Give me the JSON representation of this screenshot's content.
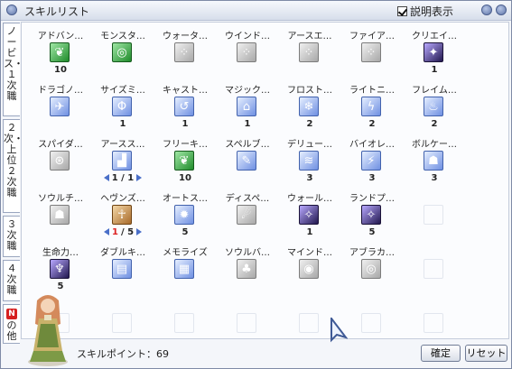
{
  "window": {
    "title": "スキルリスト",
    "show_description_label": "説明表示",
    "show_description_checked": true
  },
  "tabs": [
    {
      "label": "ノービス・１次職"
    },
    {
      "label": "２次・上位２次職"
    },
    {
      "label": "３次職"
    },
    {
      "label": "４次職"
    },
    {
      "badge": "N",
      "label": "の他"
    }
  ],
  "skills": [
    {
      "name": "アドバン…",
      "icon": "green-leaf-icon",
      "style": "green",
      "sym": "❦",
      "level": "10"
    },
    {
      "name": "モンスタ…",
      "icon": "target-icon",
      "style": "green",
      "sym": "◎",
      "level": ""
    },
    {
      "name": "ウォータ…",
      "icon": "dots-icon",
      "style": "gray",
      "sym": "⁘",
      "level": ""
    },
    {
      "name": "ウインド…",
      "icon": "dots-icon",
      "style": "gray",
      "sym": "⁘",
      "level": ""
    },
    {
      "name": "アースエ…",
      "icon": "dots-icon",
      "style": "gray",
      "sym": "⁘",
      "level": ""
    },
    {
      "name": "ファイア…",
      "icon": "dots-icon",
      "style": "gray",
      "sym": "⁘",
      "level": ""
    },
    {
      "name": "クリエイ…",
      "icon": "creature-icon",
      "style": "dark",
      "sym": "✦",
      "level": "1"
    },
    {
      "name": "ドラゴノ…",
      "icon": "dragon-icon",
      "style": "blue",
      "sym": "✈",
      "level": ""
    },
    {
      "name": "サイズミ…",
      "icon": "seismic-icon",
      "style": "blue",
      "sym": "Φ",
      "level": "1"
    },
    {
      "name": "キャスト…",
      "icon": "cast-icon",
      "style": "blue",
      "sym": "↺",
      "level": "1"
    },
    {
      "name": "マジック…",
      "icon": "magic-house-icon",
      "style": "blue",
      "sym": "⌂",
      "level": "1"
    },
    {
      "name": "フロスト…",
      "icon": "frost-icon",
      "style": "blue",
      "sym": "❄",
      "level": "2"
    },
    {
      "name": "ライトニ…",
      "icon": "lightning-icon",
      "style": "blue",
      "sym": "ϟ",
      "level": "2"
    },
    {
      "name": "フレイム…",
      "icon": "flame-icon",
      "style": "blue",
      "sym": "♨",
      "level": "2"
    },
    {
      "name": "スパイダ…",
      "icon": "spider-web-icon",
      "style": "gray",
      "sym": "⊛",
      "level": ""
    },
    {
      "name": "アースス…",
      "icon": "earth-spike-icon",
      "style": "blue",
      "sym": "▟",
      "level": "1 / 1",
      "arrows": true
    },
    {
      "name": "フリーキ…",
      "icon": "green-leaf-icon",
      "style": "green",
      "sym": "❦",
      "level": "10"
    },
    {
      "name": "スペルブ…",
      "icon": "spell-icon",
      "style": "blue",
      "sym": "✎",
      "level": ""
    },
    {
      "name": "デリュー…",
      "icon": "deluge-icon",
      "style": "blue",
      "sym": "≋",
      "level": "3"
    },
    {
      "name": "バイオレ…",
      "icon": "violent-icon",
      "style": "blue",
      "sym": "⚡",
      "level": "3"
    },
    {
      "name": "ボルケー…",
      "icon": "volcano-icon",
      "style": "blue",
      "sym": "☗",
      "level": "3"
    },
    {
      "name": "ソウルチ…",
      "icon": "soul-icon",
      "style": "gray",
      "sym": "☗",
      "level": ""
    },
    {
      "name": "ヘヴンズ…",
      "icon": "heavens-icon",
      "style": "brown",
      "sym": "☥",
      "level_cur": "1",
      "level_max": "/ 5",
      "arrows": true
    },
    {
      "name": "オートス…",
      "icon": "auto-spell-icon",
      "style": "blue",
      "sym": "✹",
      "level": "5"
    },
    {
      "name": "ディスペ…",
      "icon": "dispel-icon",
      "style": "gray",
      "sym": "☄",
      "level": ""
    },
    {
      "name": "ウォール…",
      "icon": "wall-icon",
      "style": "dark",
      "sym": "✧",
      "level": "1"
    },
    {
      "name": "ランドプ…",
      "icon": "land-protector-icon",
      "style": "dark",
      "sym": "✧",
      "level": "5"
    },
    {
      "name": "",
      "icon": "empty-slot-icon",
      "style": "empty",
      "sym": "",
      "level": ""
    },
    {
      "name": "生命力…",
      "icon": "life-icon",
      "style": "dark",
      "sym": "♆",
      "level": "5"
    },
    {
      "name": "ダブルキ…",
      "icon": "double-cast-icon",
      "style": "blue",
      "sym": "▤",
      "level": ""
    },
    {
      "name": "メモライズ",
      "icon": "memorize-icon",
      "style": "blue",
      "sym": "▦",
      "level": ""
    },
    {
      "name": "ソウルバ…",
      "icon": "soul-burn-icon",
      "style": "gray",
      "sym": "♣",
      "level": ""
    },
    {
      "name": "マインド…",
      "icon": "mind-icon",
      "style": "gray",
      "sym": "◉",
      "level": ""
    },
    {
      "name": "アブラカ…",
      "icon": "abracadabra-icon",
      "style": "gray",
      "sym": "◎",
      "level": ""
    },
    {
      "name": "",
      "icon": "empty-slot-icon",
      "style": "empty",
      "sym": "",
      "level": ""
    },
    {
      "name": "",
      "icon": "empty-slot-icon",
      "style": "empty",
      "sym": "",
      "level": ""
    },
    {
      "name": "",
      "icon": "empty-slot-icon",
      "style": "empty",
      "sym": "",
      "level": ""
    },
    {
      "name": "",
      "icon": "empty-slot-icon",
      "style": "empty",
      "sym": "",
      "level": ""
    },
    {
      "name": "",
      "icon": "empty-slot-icon",
      "style": "empty",
      "sym": "",
      "level": ""
    },
    {
      "name": "",
      "icon": "empty-slot-icon",
      "style": "empty",
      "sym": "",
      "level": ""
    },
    {
      "name": "",
      "icon": "empty-slot-icon",
      "style": "empty",
      "sym": "",
      "level": ""
    },
    {
      "name": "",
      "icon": "empty-slot-icon",
      "style": "empty",
      "sym": "",
      "level": ""
    }
  ],
  "footer": {
    "skill_points": "スキルポイント：69",
    "confirm_label": "確定",
    "reset_label": "リセット"
  }
}
